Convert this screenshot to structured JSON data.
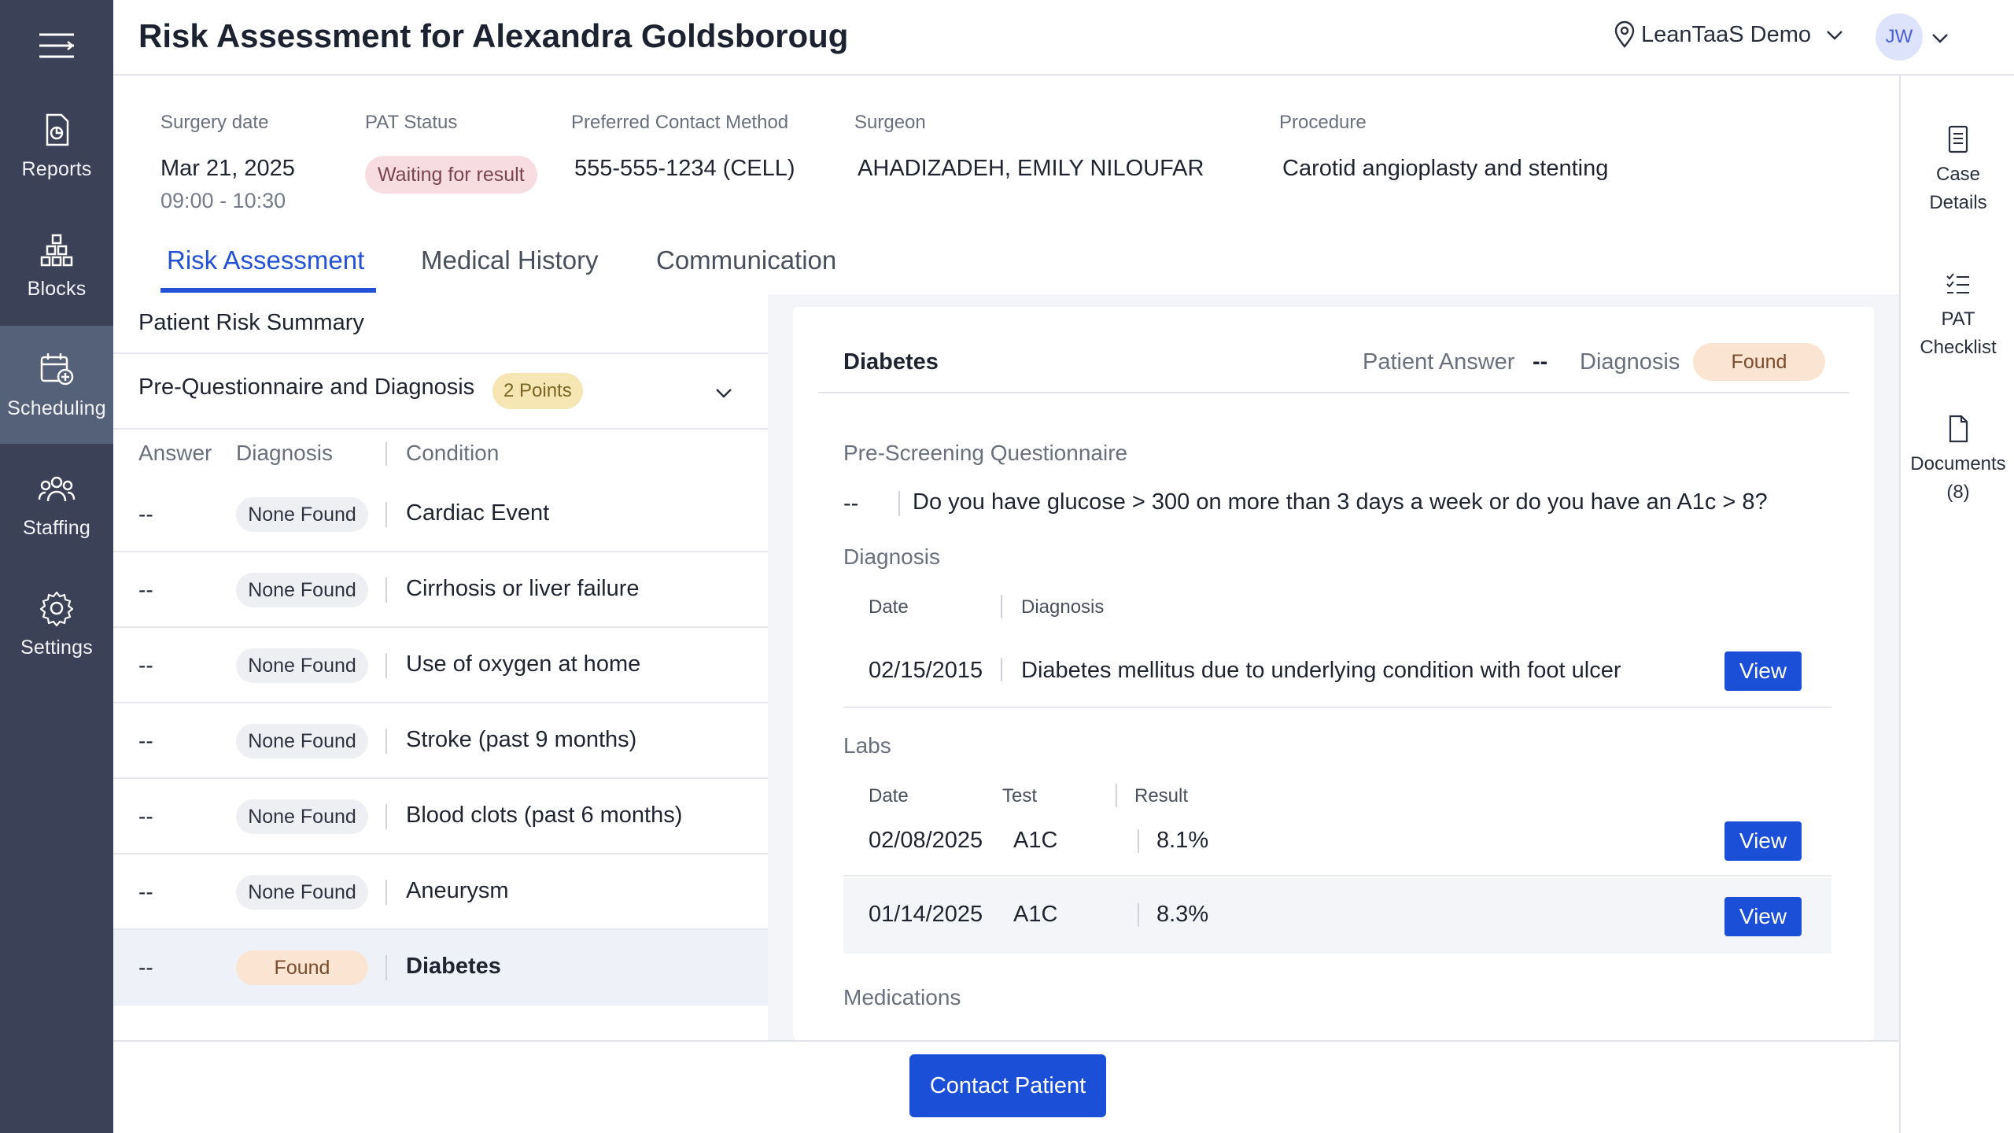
{
  "nav": {
    "items": [
      {
        "label": "Reports",
        "icon": "report-icon"
      },
      {
        "label": "Blocks",
        "icon": "blocks-icon"
      },
      {
        "label": "Scheduling",
        "icon": "calendar-plus-icon"
      },
      {
        "label": "Staffing",
        "icon": "people-icon"
      },
      {
        "label": "Settings",
        "icon": "gear-icon"
      }
    ],
    "active": "Scheduling"
  },
  "header": {
    "title": "Risk Assessment for Alexandra Goldsboroug",
    "location": "LeanTaaS Demo",
    "avatar_initials": "JW"
  },
  "right_panel": {
    "case_details_1": "Case",
    "case_details_2": "Details",
    "pat_checklist_1": "PAT",
    "pat_checklist_2": "Checklist",
    "documents_1": "Documents",
    "documents_2": "(8)"
  },
  "patient_info": {
    "surgery_date_label": "Surgery date",
    "surgery_date": "Mar 21, 2025",
    "surgery_time": "09:00 - 10:30",
    "pat_status_label": "PAT Status",
    "pat_status": "Waiting for result",
    "contact_label": "Preferred Contact Method",
    "contact": "555-555-1234 (CELL)",
    "surgeon_label": "Surgeon",
    "surgeon": "AHADIZADEH, EMILY NILOUFAR",
    "procedure_label": "Procedure",
    "procedure": "Carotid angioplasty and stenting"
  },
  "tabs": [
    "Risk Assessment",
    "Medical History",
    "Communication"
  ],
  "active_tab": "Risk Assessment",
  "risk_summary": {
    "title": "Patient Risk Summary",
    "section": "Pre-Questionnaire and Diagnosis",
    "points": "2 Points",
    "headers": {
      "answer": "Answer",
      "diagnosis": "Diagnosis",
      "condition": "Condition"
    },
    "rows": [
      {
        "answer": "--",
        "diagnosis": "None Found",
        "condition": "Cardiac Event"
      },
      {
        "answer": "--",
        "diagnosis": "None Found",
        "condition": "Cirrhosis or liver failure"
      },
      {
        "answer": "--",
        "diagnosis": "None Found",
        "condition": "Use of oxygen at home"
      },
      {
        "answer": "--",
        "diagnosis": "None Found",
        "condition": "Stroke (past 9 months)"
      },
      {
        "answer": "--",
        "diagnosis": "None Found",
        "condition": "Blood clots (past 6 months)"
      },
      {
        "answer": "--",
        "diagnosis": "None Found",
        "condition": "Aneurysm"
      },
      {
        "answer": "--",
        "diagnosis": "Found",
        "condition": "Diabetes"
      }
    ]
  },
  "detail": {
    "title": "Diabetes",
    "patient_answer_label": "Patient Answer",
    "patient_answer": "--",
    "diagnosis_label": "Diagnosis",
    "diagnosis_status": "Found",
    "prescreen_label": "Pre-Screening Questionnaire",
    "question_answer": "--",
    "question": "Do you have glucose > 300 on more than 3 days a week or do you have an A1c > 8?",
    "diagnosis_section": "Diagnosis",
    "diag_headers": {
      "date": "Date",
      "diagnosis": "Diagnosis"
    },
    "diag_rows": [
      {
        "date": "02/15/2015",
        "diagnosis": "Diabetes mellitus due to underlying condition with foot ulcer",
        "action": "View"
      }
    ],
    "labs_section": "Labs",
    "lab_headers": {
      "date": "Date",
      "test": "Test",
      "result": "Result"
    },
    "lab_rows": [
      {
        "date": "02/08/2025",
        "test": "A1C",
        "result": "8.1%",
        "action": "View"
      },
      {
        "date": "01/14/2025",
        "test": "A1C",
        "result": "8.3%",
        "action": "View"
      }
    ],
    "medications_section": "Medications"
  },
  "footer": {
    "contact_button": "Contact Patient"
  },
  "colors": {
    "nav_bg": "#3b4257",
    "nav_active": "#556079",
    "accent": "#2452d6",
    "button": "#1c4fd8",
    "found_badge": "#fbe4d2",
    "none_found_badge": "#eeeff2",
    "points_badge": "#f6e6b4",
    "pat_status_badge": "#f7dde2"
  }
}
